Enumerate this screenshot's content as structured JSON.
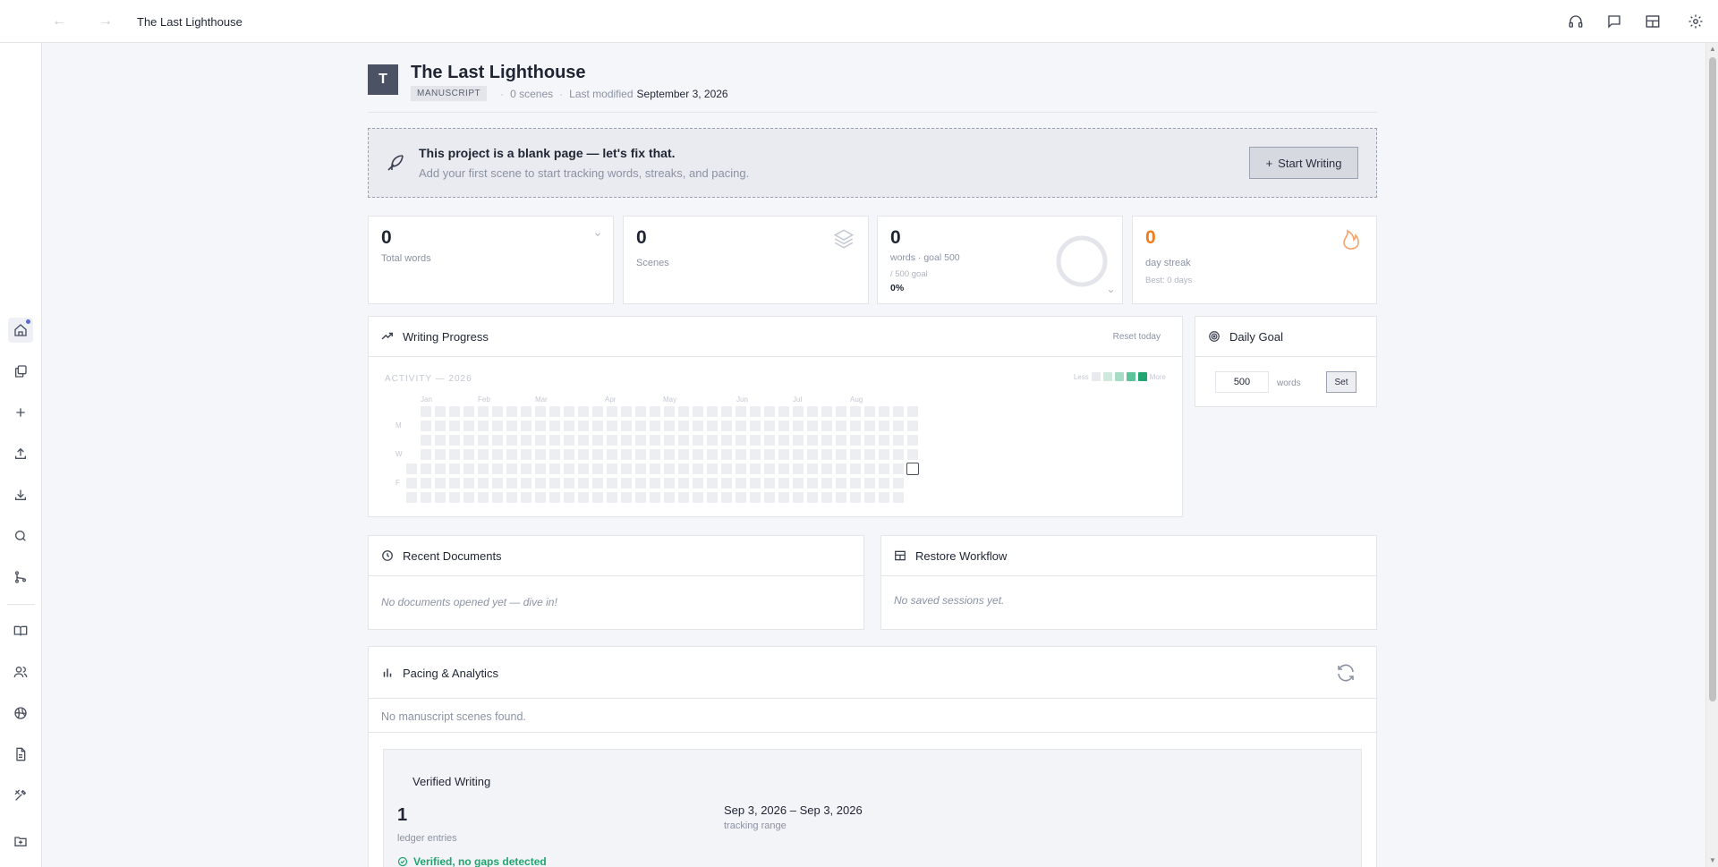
{
  "topbar": {
    "title": "The Last Lighthouse",
    "back": "←",
    "forward": "→"
  },
  "project": {
    "initial": "T",
    "title": "The Last Lighthouse",
    "badge": "MANUSCRIPT",
    "scenes_text": "0 scenes",
    "modified_label": "Last modified",
    "modified_date": "September 3, 2026"
  },
  "banner": {
    "title": "This project is a blank page — let's fix that.",
    "subtitle": "Add your first scene to start tracking words, streaks, and pacing.",
    "button_icon": "+",
    "button_label": "Start Writing"
  },
  "stats": {
    "total_words": {
      "value": "0",
      "label": "Total words"
    },
    "scenes": {
      "value": "0",
      "label": "Scenes"
    },
    "goal": {
      "value": "0",
      "label": "words · goal 500",
      "sub": "/ 500 goal",
      "pct": "0%",
      "progress": 0
    },
    "streak": {
      "value": "0",
      "label": "day streak",
      "best": "Best: 0 days"
    }
  },
  "writing_progress": {
    "title": "Writing Progress",
    "reset": "Reset today",
    "activity_title": "ACTIVITY — 2026",
    "legend_less": "Less",
    "legend_more": "More",
    "legend_colors": [
      "#e8eaee",
      "#cfe9dd",
      "#a7dcc4",
      "#5cc39a",
      "#21a56f"
    ],
    "months": [
      "Jan",
      "Feb",
      "Mar",
      "Apr",
      "May",
      "Jun",
      "Jul",
      "Aug"
    ],
    "days": [
      "M",
      "W",
      "F"
    ]
  },
  "daily_goal": {
    "title": "Daily Goal",
    "value": "500",
    "unit": "words",
    "set_label": "Set"
  },
  "recent_documents": {
    "title": "Recent Documents",
    "empty": "No documents opened yet — dive in!"
  },
  "restore_workflow": {
    "title": "Restore Workflow",
    "empty": "No saved sessions yet."
  },
  "pacing": {
    "title": "Pacing & Analytics",
    "empty": "No manuscript scenes found.",
    "verified": {
      "title": "Verified Writing",
      "entries_value": "1",
      "entries_label": "ledger entries",
      "range_value": "Sep 3, 2026 – Sep 3, 2026",
      "range_label": "tracking range",
      "status": "Verified, no gaps detected"
    }
  },
  "colors": {
    "accent_orange": "#f07c1e",
    "green": "#21a56f",
    "dark": "#4a5263"
  }
}
